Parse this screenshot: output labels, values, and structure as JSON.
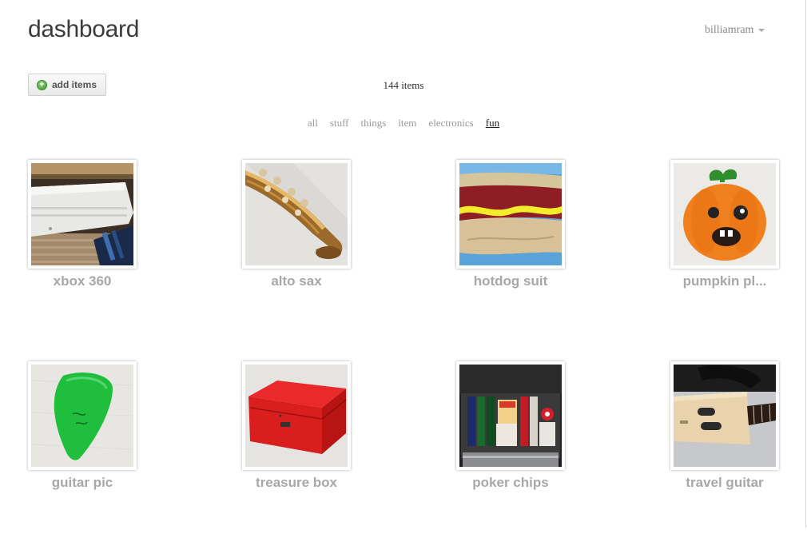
{
  "header": {
    "title": "dashboard",
    "user": "billiamram"
  },
  "toolbar": {
    "add_label": "add items",
    "count_text": "144 items"
  },
  "filters": {
    "all": "all",
    "stuff": "stuff",
    "things": "things",
    "item": "item",
    "electronics": "electronics",
    "fun": "fun",
    "active": "fun"
  },
  "items": [
    {
      "name": "xbox 360",
      "image": "xbox-photo"
    },
    {
      "name": "alto sax",
      "image": "saxophone-photo"
    },
    {
      "name": "hotdog suit",
      "image": "hotdog-suit-photo"
    },
    {
      "name": "pumpkin pl...",
      "image": "pumpkin-plush-photo"
    },
    {
      "name": "guitar pic",
      "image": "guitar-pick-photo"
    },
    {
      "name": "treasure box",
      "image": "red-box-photo"
    },
    {
      "name": "poker chips",
      "image": "poker-case-photo"
    },
    {
      "name": "travel guitar",
      "image": "travel-guitar-photo"
    }
  ]
}
